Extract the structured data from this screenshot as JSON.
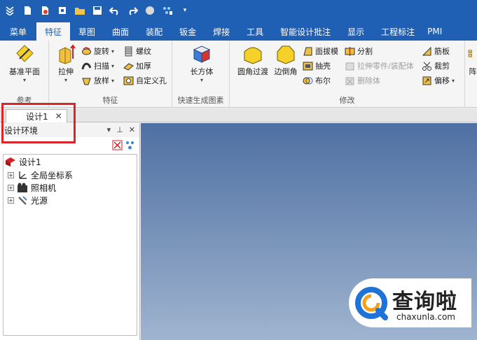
{
  "quick_access": {
    "icons": [
      "menu-icon",
      "new-icon",
      "open-icon",
      "import-icon",
      "folder-icon",
      "save-icon",
      "undo-icon",
      "redo-icon",
      "render-icon",
      "custom-icon",
      "more-icon"
    ]
  },
  "tabs": [
    {
      "label": "菜单"
    },
    {
      "label": "特征"
    },
    {
      "label": "草图"
    },
    {
      "label": "曲面"
    },
    {
      "label": "装配"
    },
    {
      "label": "钣金"
    },
    {
      "label": "焊接"
    },
    {
      "label": "工具"
    },
    {
      "label": "智能设计批注"
    },
    {
      "label": "显示"
    },
    {
      "label": "工程标注"
    },
    {
      "label": "PMI"
    }
  ],
  "ribbon": {
    "reference": {
      "label": "参考",
      "datum_plane": "基准平面"
    },
    "feature": {
      "label": "特征",
      "extrude": "拉伸",
      "revolve": "旋转",
      "sweep": "扫描",
      "loft": "放样",
      "thread": "螺纹",
      "thicken": "加厚",
      "custom_hole": "自定义孔"
    },
    "quick": {
      "label": "快速生成图素",
      "box": "长方体"
    },
    "modify": {
      "label": "修改",
      "fillet": "圆角过渡",
      "chamfer": "边倒角",
      "draft": "面拔模",
      "shell": "抽壳",
      "boolean": "布尔",
      "split": "分割",
      "extrude_to_part": "拉伸零件/装配体",
      "delete_body": "删除体",
      "rib": "筋板",
      "trim": "裁剪",
      "offset": "偏移"
    },
    "partial_tab": "阵"
  },
  "document": {
    "tab_label": "设计1"
  },
  "panel": {
    "title": "设计环境",
    "tree": [
      {
        "label": "设计1"
      },
      {
        "label": "全局坐标系"
      },
      {
        "label": "照相机"
      },
      {
        "label": "光源"
      }
    ]
  },
  "watermark": {
    "title": "查询啦",
    "url": "chaxunla.com"
  }
}
